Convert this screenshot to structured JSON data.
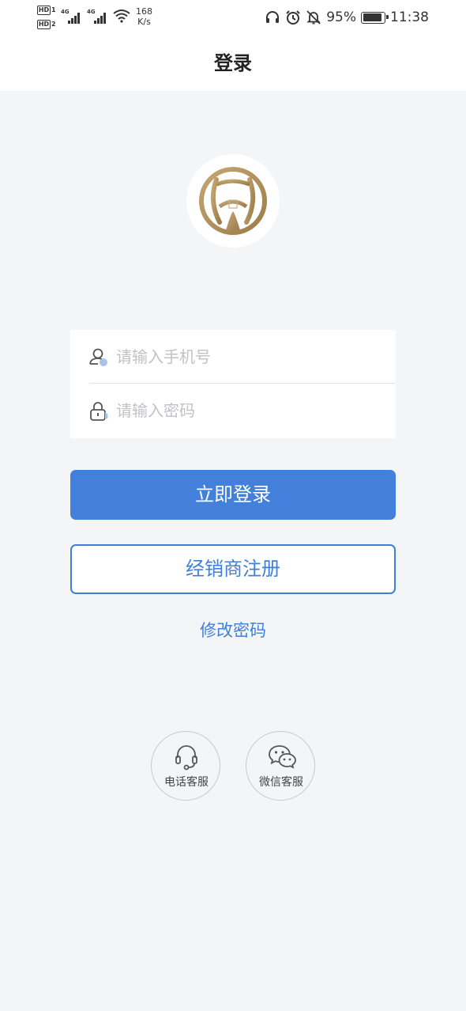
{
  "status_bar": {
    "hd1": "HD",
    "hd1_num": "1",
    "hd2": "HD",
    "hd2_num": "2",
    "net1": "4G",
    "net2": "4G",
    "speed_value": "168",
    "speed_unit": "K/s",
    "battery_percent": "95%",
    "time": "11:38",
    "battery_level": 0.95,
    "icons": [
      "headphones-icon",
      "alarm-icon",
      "bell-off-icon",
      "battery-icon",
      "wifi-icon",
      "signal-icon"
    ]
  },
  "header": {
    "title": "登录"
  },
  "login_form": {
    "phone_placeholder": "请输入手机号",
    "password_placeholder": "请输入密码",
    "phone_icon": "user-icon",
    "password_icon": "lock-icon"
  },
  "actions": {
    "login_label": "立即登录",
    "register_label": "经销商注册",
    "change_password_label": "修改密码"
  },
  "service": {
    "phone_label": "电话客服",
    "phone_icon": "headset-icon",
    "wechat_label": "微信客服",
    "wechat_icon": "wechat-icon"
  },
  "colors": {
    "primary": "#4280db",
    "link": "#3f7fd8",
    "background": "#f4f5f7",
    "logo_gold": "#b0915f"
  }
}
